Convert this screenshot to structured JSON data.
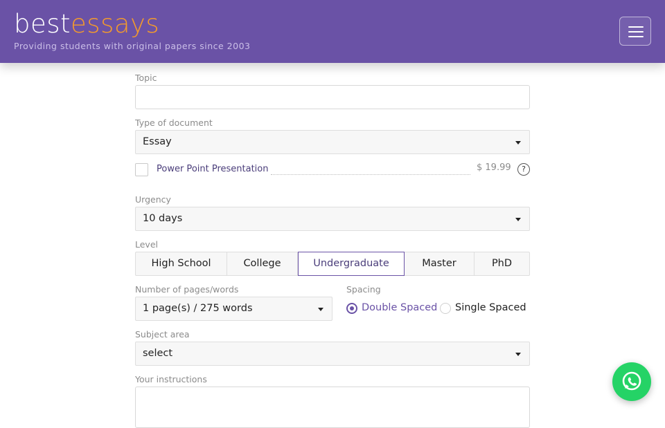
{
  "header": {
    "logo_part1": "best",
    "logo_part2": "essays",
    "tagline": "Providing students with original papers since 2003",
    "menu_icon": "hamburger-icon"
  },
  "form": {
    "topic": {
      "label": "Topic",
      "value": ""
    },
    "document_type": {
      "label": "Type of document",
      "value": "Essay"
    },
    "addon": {
      "label": "Power Point Presentation",
      "price": "$ 19.99",
      "help": "?",
      "checked": false
    },
    "urgency": {
      "label": "Urgency",
      "value": "10 days"
    },
    "level": {
      "label": "Level",
      "options": [
        "High School",
        "College",
        "Undergraduate",
        "Master",
        "PhD"
      ],
      "selected": "Undergraduate"
    },
    "pages": {
      "label": "Number of pages/words",
      "value": "1 page(s) / 275 words"
    },
    "spacing": {
      "label": "Spacing",
      "options": [
        "Double Spaced",
        "Single Spaced"
      ],
      "selected": "Double Spaced"
    },
    "subject": {
      "label": "Subject area",
      "value": "select"
    },
    "instructions": {
      "label": "Your instructions",
      "value": ""
    }
  },
  "chat": {
    "icon": "whatsapp-icon"
  },
  "colors": {
    "brand_purple": "#6a52a6",
    "brand_orange": "#f39a2c",
    "whatsapp_green": "#25d366"
  }
}
